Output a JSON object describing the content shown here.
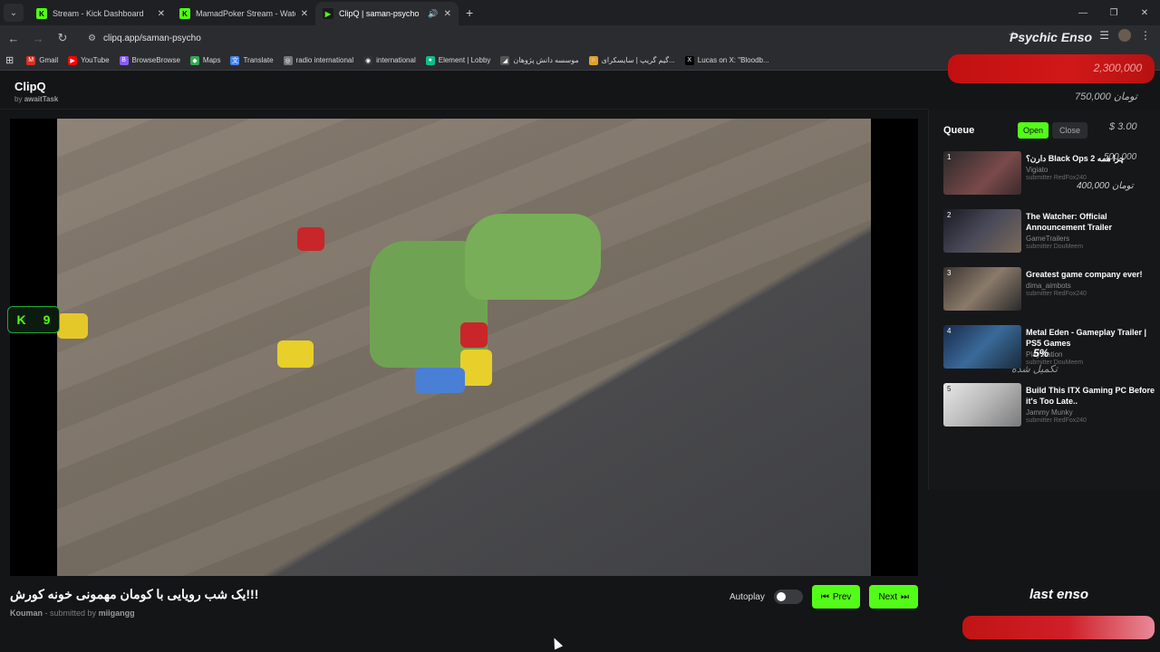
{
  "browser": {
    "tabs": [
      {
        "title": "Stream - Kick Dashboard",
        "favicon": "K",
        "favicon_color": "#53fc18",
        "active": false
      },
      {
        "title": "MamadPoker Stream - Watch L",
        "favicon": "K",
        "favicon_color": "#53fc18",
        "active": false
      },
      {
        "title": "ClipQ | saman-psycho",
        "favicon": "▶",
        "favicon_color": "#53fc18",
        "active": true
      }
    ],
    "url": "clipq.app/saman-psycho",
    "bookmarks": [
      {
        "label": "Gmail",
        "icon": "M",
        "color": "#d93025"
      },
      {
        "label": "YouTube",
        "icon": "▶",
        "color": "#ff0000"
      },
      {
        "label": "BrowseBrowse",
        "icon": "B",
        "color": "#8a5cf6"
      },
      {
        "label": "Maps",
        "icon": "◆",
        "color": "#34a853"
      },
      {
        "label": "Translate",
        "icon": "文",
        "color": "#4285f4"
      },
      {
        "label": "radio international",
        "icon": "◎",
        "color": "#777"
      },
      {
        "label": "international",
        "icon": "◉",
        "color": "#333"
      },
      {
        "label": "Element | Lobby",
        "icon": "●",
        "color": "#0dbd8b"
      },
      {
        "label": "موسسه دانش پژوهان",
        "icon": "◢",
        "color": "#555"
      },
      {
        "label": "گیم گریپ | سایسکرای...",
        "icon": "○",
        "color": "#e0a030"
      },
      {
        "label": "Lucas on X: \"Bloodb...",
        "icon": "X",
        "color": "#000"
      }
    ]
  },
  "app": {
    "name": "ClipQ",
    "by_prefix": "by",
    "by_author": "awaitTask"
  },
  "kick_badge": {
    "count": "9"
  },
  "clip": {
    "title": "!!!یک شب رویایی با کومان مهمونی خونه کورش",
    "channel": "Kouman",
    "submitted_prefix": "- submitted by",
    "submitter": "miigangg"
  },
  "controls": {
    "autoplay_label": "Autoplay",
    "prev_label": "Prev",
    "next_label": "Next"
  },
  "queue": {
    "title": "Queue",
    "open_label": "Open",
    "close_label": "Close",
    "items": [
      {
        "num": "1",
        "title": "چرا همه Black Ops 2 دارن؟",
        "author": "Vigiato",
        "submitter": "submitter RedFox240",
        "thumb_color": "#7a4a4a"
      },
      {
        "num": "2",
        "title": "The Watcher: Official Announcement Trailer",
        "author": "GameTrailers",
        "submitter": "submitter DouMeem",
        "thumb_color": "#3a3a4a"
      },
      {
        "num": "3",
        "title": "Greatest game company ever!",
        "author": "dima_aimbots",
        "submitter": "submitter RedFox240",
        "thumb_color": "#5a4a40"
      },
      {
        "num": "4",
        "title": "Metal Eden - Gameplay Trailer | PS5 Games",
        "author": "PlayStation",
        "submitter": "submitter DouMeem",
        "thumb_color": "#2a4a6a"
      },
      {
        "num": "5",
        "title": "Build This ITX Gaming PC Before it's Too Late..",
        "author": "Jammy Munky",
        "submitter": "submitter RedFox240",
        "thumb_color": "#c8c8c8"
      }
    ]
  },
  "overlay": {
    "brand": "Psychic Enso",
    "top_amount": "2,300,000",
    "sub_amount": "750,000 تومان",
    "usd": "$ 3.00",
    "amount_a": "500,000",
    "amount_b": "400,000 تومان",
    "percent": "5%",
    "done_label": "تکمیل شده",
    "footer_name": "last enso"
  }
}
